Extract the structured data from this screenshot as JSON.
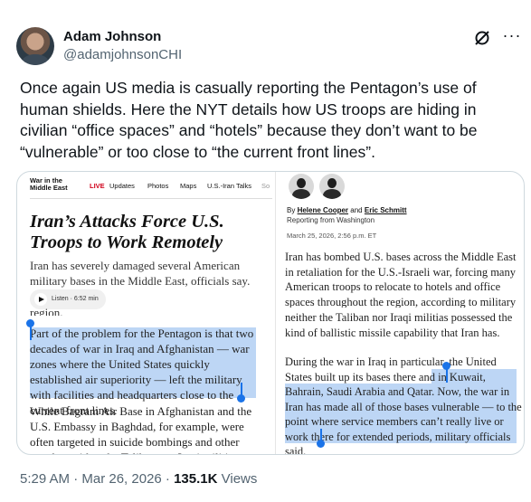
{
  "author": {
    "name": "Adam Johnson",
    "handle": "@adamjohnsonCHI"
  },
  "icons": {
    "grok": "grok-icon",
    "more": "more-icon"
  },
  "tweet": {
    "text": "Once again US media is casually reporting the Pentagon’s use of human shields. Here the NYT details how US troops are hiding in civilian “office spaces” and “hotels” because they don’t want to be “vulnerable” or too close to “the current front lines”."
  },
  "article": {
    "nav": {
      "section": "War in the Middle East",
      "live": "LIVE",
      "items": [
        "Updates",
        "Photos",
        "Maps",
        "U.S.-Iran Talks",
        "So"
      ]
    },
    "headline": "Iran’s Attacks Force U.S. Troops to Work Remotely",
    "dek": "Iran has severely damaged several American military bases in the Middle East, officials say.",
    "listen_label": "Listen · 6:52 min",
    "region_cut": "region.",
    "left_highlight": "Part of the problem for the Pentagon is that two decades of war in Iraq and Afghanistan — war zones where the United States quickly established air superiority — left the military with facilities and headquarters close to the current front lines.",
    "left_body2": "While Bagram Air Base in Afghanistan and the U.S. Embassy in Baghdad, for example, were often targeted in suicide bombings and other attacks, neither the Taliban nor Iraqi militias possessed the",
    "byline_prefix": "By",
    "byline_author1": "Helene Cooper",
    "byline_and": "and",
    "byline_author2": "Eric Schmitt",
    "reporting": "Reporting from Washington",
    "dateline": "March 25, 2026, 2:56 p.m. ET",
    "right_body1": "Iran has bombed U.S. bases across the Middle East in retaliation for the U.S.-Israeli war, forcing many American troops to relocate to hotels and office spaces throughout the region, according to military personnel and American officials.",
    "right_body2": "neither the Taliban nor Iraqi militias possessed the kind of ballistic missile capability that Iran has.",
    "right_body3_plain": "During the war in Iraq in particular, the United States built up its bases there and in Kuwait, Bahrain, Saudi Arabia and Qatar. ",
    "right_body3_highlight": "Now, the war in Iran has made all of those bases vulnerable — to the point where service members can’t really live or work there for extended periods, military officials said."
  },
  "meta": {
    "time": "5:29 AM · Mar 26, 2026 · ",
    "views_count": "135.1K",
    "views_label": " Views"
  }
}
